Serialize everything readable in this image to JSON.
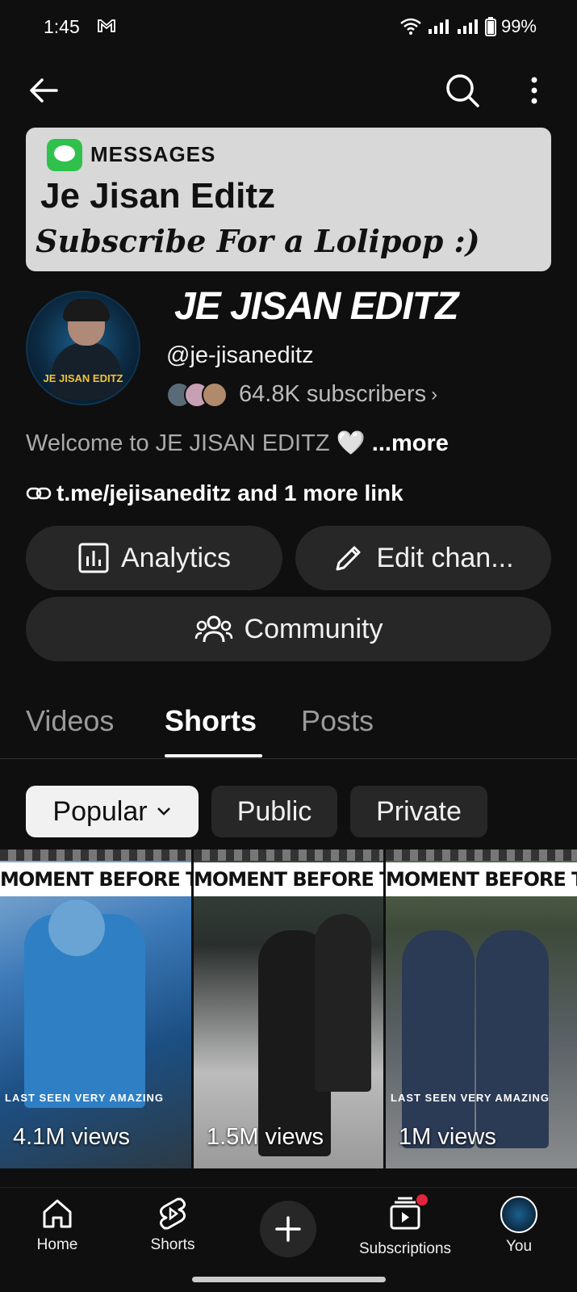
{
  "status_bar": {
    "time": "1:45",
    "battery": "99%"
  },
  "banner": {
    "messages_label": "MESSAGES",
    "title": "Je Jisan Editz",
    "subtitle": "Subscribe For a Lolipop :)"
  },
  "channel": {
    "avatar_text": "JE JISAN EDITZ",
    "name": "JE JISAN EDITZ",
    "handle": "@je-jisaneditz",
    "subscribers": "64.8K subscribers",
    "description": "Welcome to JE JISAN EDITZ",
    "description_more": "...more",
    "link_main": "t.me/jejisaneditz",
    "link_more": "and 1 more link"
  },
  "actions": {
    "analytics": "Analytics",
    "edit_channel": "Edit chan...",
    "community": "Community"
  },
  "tabs": [
    {
      "label": "Videos"
    },
    {
      "label": "Shorts"
    },
    {
      "label": "Posts"
    }
  ],
  "filter_chips": [
    {
      "label": "Popular"
    },
    {
      "label": "Public"
    },
    {
      "label": "Private"
    }
  ],
  "shorts": [
    {
      "caption": "MOMENT BEFORE TWIST",
      "bottom_text": "LAST SEEN VERY AMAZING",
      "views": "4.1M views"
    },
    {
      "caption": "MOMENT BEFORE TWIST",
      "bottom_text": "",
      "views": "1.5M views"
    },
    {
      "caption": "MOMENT BEFORE TWIST",
      "bottom_text": "LAST SEEN VERY AMAZING",
      "views": "1M views"
    }
  ],
  "bottom_nav": {
    "home": "Home",
    "shorts": "Shorts",
    "subscriptions": "Subscriptions",
    "you": "You"
  },
  "colors": {
    "background": "#0f0f0f",
    "pill": "#272727",
    "notification": "#e0243b"
  }
}
